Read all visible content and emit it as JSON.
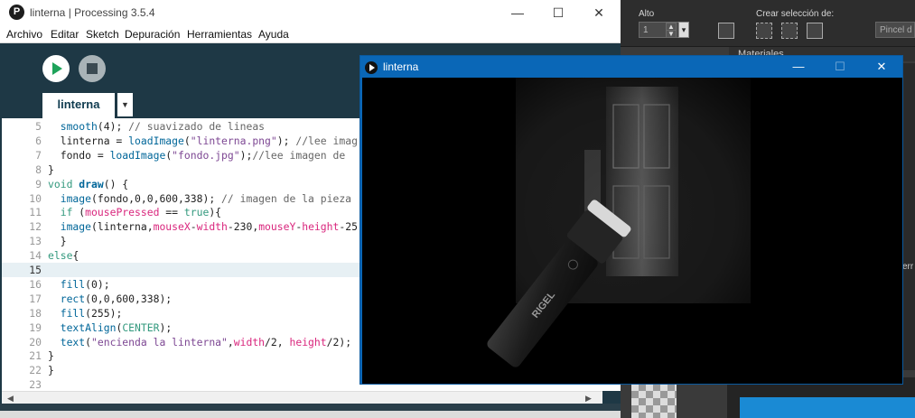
{
  "background_app": {
    "alto_label": "Alto",
    "alto_value": "1",
    "spin_up": "▲",
    "spin_down": "▼",
    "dropdown_arrow": "▾",
    "crear_label": "Crear selección de:",
    "pincel_label": "Pincel d",
    "materiales_label": "Materiales",
    "layer_edge_text": "err"
  },
  "ide": {
    "window_title": "linterna | Processing 3.5.4",
    "title_icon": "P",
    "window_buttons": {
      "minimize": "—",
      "maximize": "☐",
      "close": "✕"
    },
    "menu": [
      "Archivo",
      "Editar",
      "Sketch",
      "Depuración",
      "Herramientas",
      "Ayuda"
    ],
    "tab_label": "linterna",
    "tab_menu_arrow": "▼",
    "scroll_left": "◀",
    "scroll_right": "▶",
    "code": [
      {
        "n": "5",
        "t": "  smooth(4); // suavizado de lineas"
      },
      {
        "n": "6",
        "t": "  linterna = loadImage(\"linterna.png\"); //lee imag"
      },
      {
        "n": "7",
        "t": "  fondo = loadImage(\"fondo.jpg\");//lee imagen de"
      },
      {
        "n": "8",
        "t": "}"
      },
      {
        "n": "9",
        "t": "void draw() {"
      },
      {
        "n": "10",
        "t": "  image(fondo,0,0,600,338); // imagen de la pieza"
      },
      {
        "n": "11",
        "t": "  if (mousePressed == true){"
      },
      {
        "n": "12",
        "t": "  image(linterna,mouseX-width-230,mouseY-height-25"
      },
      {
        "n": "13",
        "t": "  }"
      },
      {
        "n": "14",
        "t": "else{"
      },
      {
        "n": "15",
        "t": ""
      },
      {
        "n": "16",
        "t": "  fill(0);"
      },
      {
        "n": "17",
        "t": "  rect(0,0,600,338);"
      },
      {
        "n": "18",
        "t": "  fill(255);"
      },
      {
        "n": "19",
        "t": "  textAlign(CENTER);"
      },
      {
        "n": "20",
        "t": "  text(\"encienda la linterna\",width/2, height/2);"
      },
      {
        "n": "21",
        "t": "}"
      },
      {
        "n": "22",
        "t": "}"
      },
      {
        "n": "23",
        "t": ""
      }
    ],
    "active_line": "15"
  },
  "sketch_window": {
    "title": "linterna",
    "window_buttons": {
      "minimize": "—",
      "maximize": "☐",
      "close": "✕"
    },
    "flashlight_brand": "RIGEL"
  }
}
